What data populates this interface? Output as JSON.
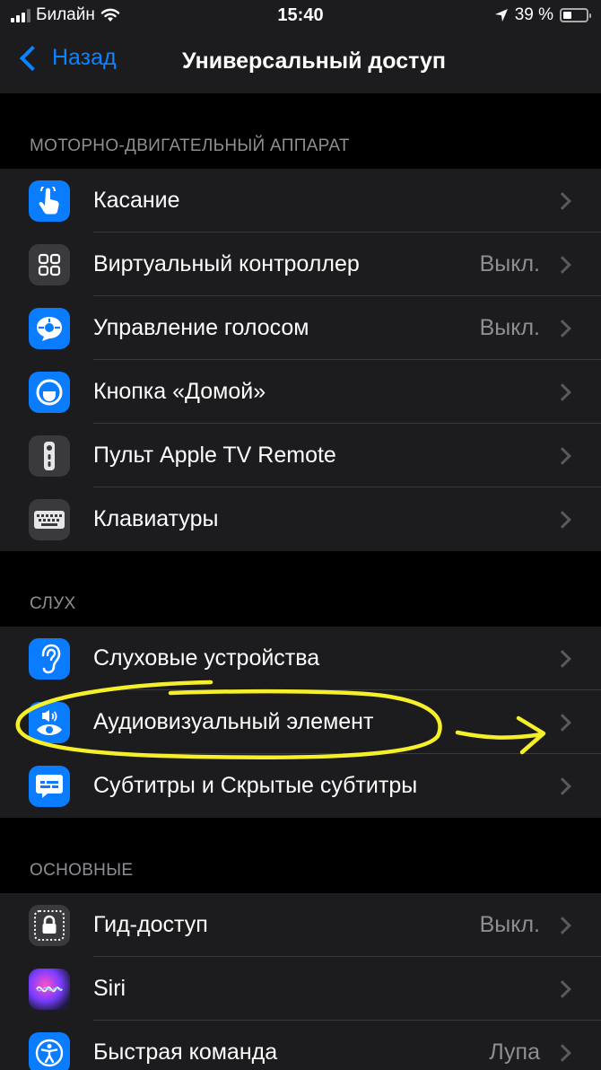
{
  "status_bar": {
    "carrier": "Билайн",
    "time": "15:40",
    "battery": "39 %",
    "battery_level": 0.39
  },
  "nav": {
    "back_label": "Назад",
    "title": "Универсальный доступ"
  },
  "sections": [
    {
      "header": "МОТОРНО-ДВИГАТЕЛЬНЫЙ АППАРАТ",
      "rows": [
        {
          "label": "Касание",
          "value": "",
          "icon": "hand-touch-icon"
        },
        {
          "label": "Виртуальный контроллер",
          "value": "Выкл.",
          "icon": "grid-icon"
        },
        {
          "label": "Управление голосом",
          "value": "Выкл.",
          "icon": "voice-control-icon"
        },
        {
          "label": "Кнопка «Домой»",
          "value": "",
          "icon": "home-button-icon"
        },
        {
          "label": "Пульт Apple TV Remote",
          "value": "",
          "icon": "remote-icon"
        },
        {
          "label": "Клавиатуры",
          "value": "",
          "icon": "keyboard-icon"
        }
      ]
    },
    {
      "header": "СЛУХ",
      "rows": [
        {
          "label": "Слуховые устройства",
          "value": "",
          "icon": "ear-icon"
        },
        {
          "label": "Аудиовизуальный элемент",
          "value": "",
          "icon": "audio-visual-icon"
        },
        {
          "label": "Субтитры и Скрытые субтитры",
          "value": "",
          "icon": "subtitles-icon"
        }
      ]
    },
    {
      "header": "ОСНОВНЫЕ",
      "rows": [
        {
          "label": "Гид-доступ",
          "value": "Выкл.",
          "icon": "lock-icon"
        },
        {
          "label": "Siri",
          "value": "",
          "icon": "siri-icon"
        },
        {
          "label": "Быстрая команда",
          "value": "Лупа",
          "icon": "accessibility-icon"
        }
      ]
    }
  ],
  "colors": {
    "accent": "#0a84ff",
    "annotation": "#f5f02a"
  }
}
